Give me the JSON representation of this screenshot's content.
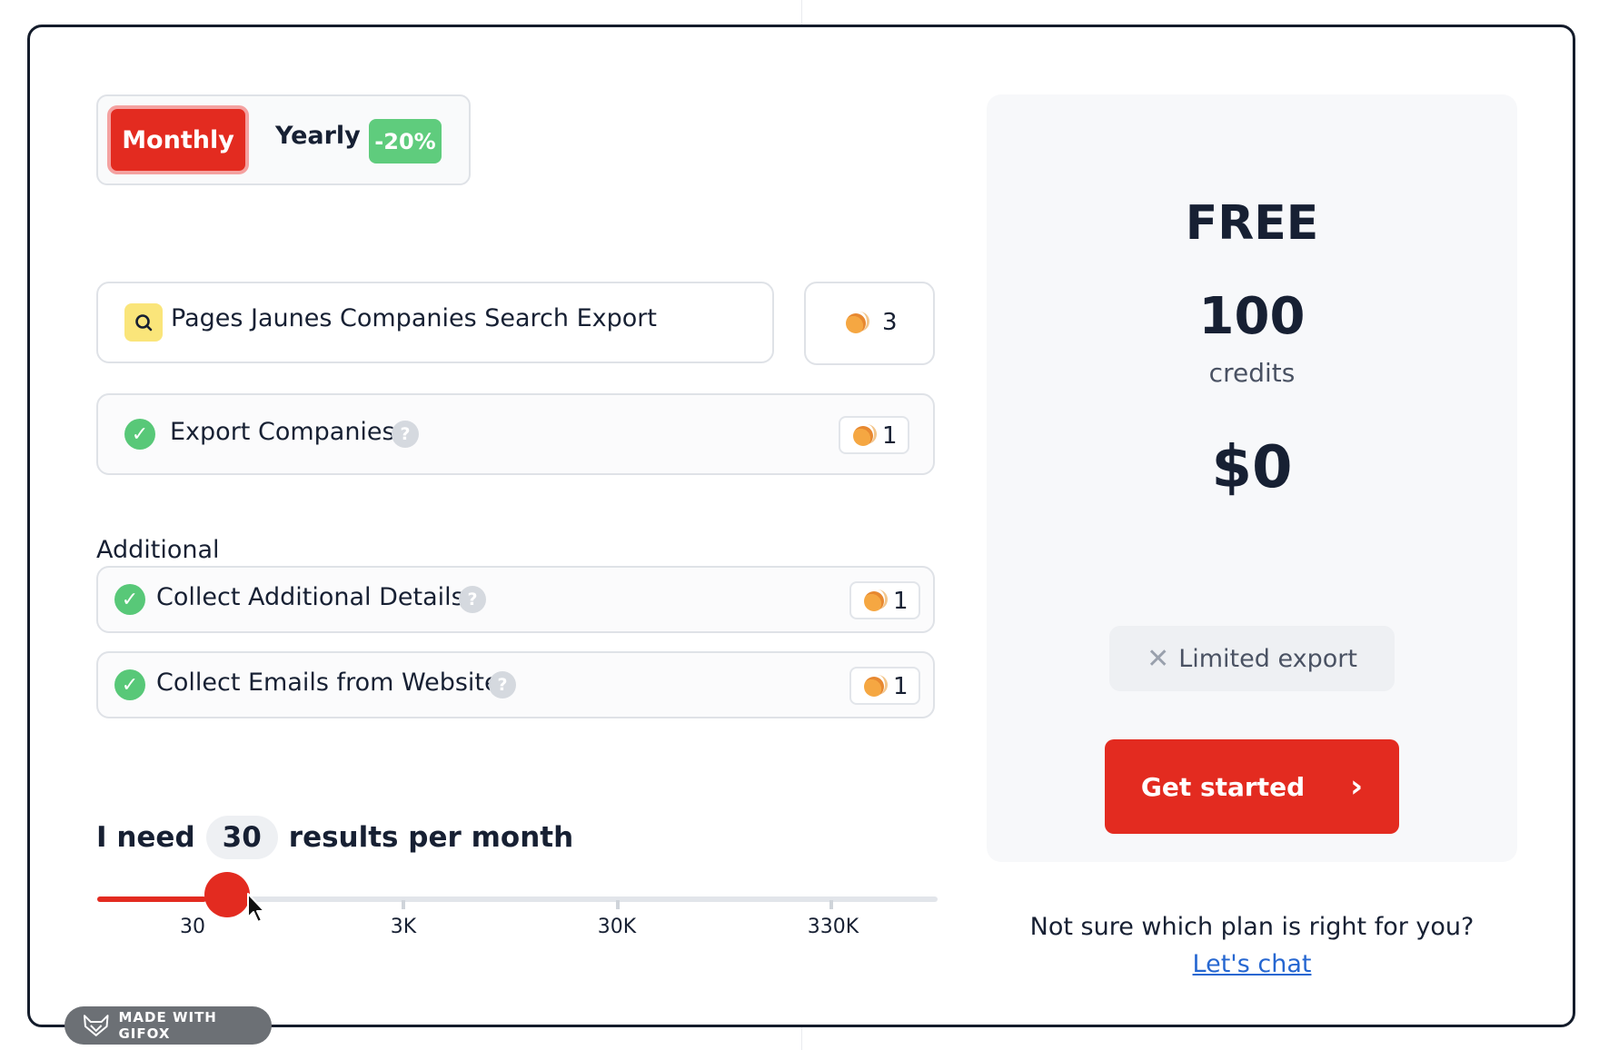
{
  "billing_toggle": {
    "monthly_label": "Monthly",
    "yearly_label": "Yearly",
    "yearly_discount": "-20%",
    "selected": "Monthly"
  },
  "main_feature": {
    "icon": "search-icon",
    "label": "Pages Jaunes Companies Search Export",
    "credits": "3"
  },
  "included_features": [
    {
      "label": "Export Companies",
      "credits": "1"
    }
  ],
  "additional": {
    "title": "Additional",
    "items": [
      {
        "label": "Collect Additional Details",
        "credits": "1"
      },
      {
        "label": "Collect Emails from Website",
        "credits": "1"
      }
    ]
  },
  "volume": {
    "prefix": "I need",
    "value": "30",
    "suffix": "results per month",
    "slider_fraction": 0.0,
    "ticks": [
      "30",
      "3K",
      "30K",
      "330K"
    ]
  },
  "plan": {
    "name": "FREE",
    "credits": "100",
    "credits_label": "credits",
    "price": "$0",
    "limitation": "Limited export",
    "cta_label": "Get started",
    "cta_arrow": "›"
  },
  "footer": {
    "question": "Not sure which plan is right for you?",
    "chat_link": "Let's chat"
  },
  "watermark": "MADE WITH GIFOX",
  "colors": {
    "accent": "#e32b20",
    "success": "#58c878",
    "discount": "#5fcc7d",
    "link": "#2667d1"
  }
}
